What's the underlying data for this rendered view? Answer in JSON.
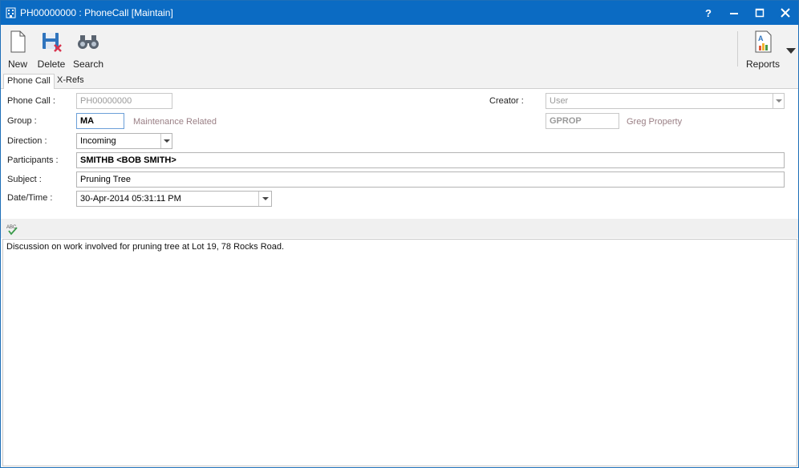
{
  "window": {
    "title": "PH00000000 : PhoneCall [Maintain]",
    "controls": {
      "help": "?",
      "minimize": "—",
      "maximize": "☐",
      "close": "✕"
    }
  },
  "toolbar": {
    "new_label": "New",
    "delete_label": "Delete",
    "search_label": "Search",
    "reports_label": "Reports"
  },
  "tabs": [
    {
      "label": "Phone Call",
      "active": true
    },
    {
      "label": "X-Refs",
      "active": false
    }
  ],
  "form": {
    "phone_call": {
      "label": "Phone Call :",
      "value": "PH00000000"
    },
    "group": {
      "label": "Group :",
      "value": "MA",
      "description": "Maintenance Related"
    },
    "direction": {
      "label": "Direction :",
      "value": "Incoming"
    },
    "participants": {
      "label": "Participants :",
      "value": "SMITHB <BOB SMITH>"
    },
    "subject": {
      "label": "Subject :",
      "value": "Pruning Tree"
    },
    "datetime": {
      "label": "Date/Time :",
      "value": "30-Apr-2014 05:31:11 PM"
    },
    "creator": {
      "label": "Creator :",
      "value": "User",
      "code": "GPROP",
      "description": "Greg Property"
    }
  },
  "notes": {
    "spellcheck_label": "ABC",
    "text": "Discussion on work involved for pruning tree at Lot 19, 78 Rocks Road."
  },
  "colors": {
    "titlebar": "#0b6bc3",
    "toolbar_bg": "#f2f2f2",
    "description_text": "#9a7f85"
  }
}
